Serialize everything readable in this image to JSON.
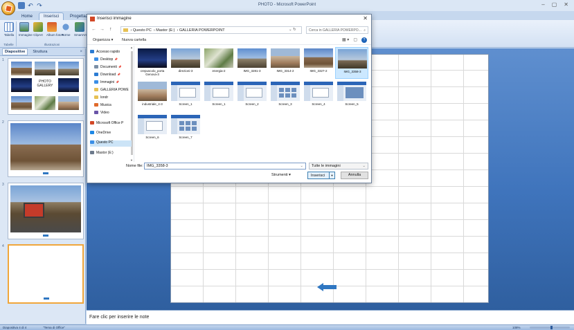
{
  "app": {
    "title": "PHOTO - Microsoft PowerPoint",
    "window_controls": [
      "–",
      "▢",
      "✕"
    ]
  },
  "ribbon": {
    "tabs": [
      "Home",
      "Inserisci",
      "Progettazione"
    ],
    "active_tab": "Inserisci",
    "groups": [
      {
        "label": "Tabelle",
        "buttons": [
          "Tabella"
        ]
      },
      {
        "label": "Illustrazioni",
        "buttons": [
          "Immagine",
          "ClipArt",
          "Album foto ▾",
          "Forme",
          "SmartArt"
        ]
      }
    ]
  },
  "left_pane": {
    "tabs": [
      "Diapositive",
      "Struttura"
    ],
    "close": "×",
    "slides": [
      {
        "number": "1",
        "caption": "PHOTO\nGALLERY"
      },
      {
        "number": "2"
      },
      {
        "number": "3"
      },
      {
        "number": "4"
      }
    ]
  },
  "notes": {
    "placeholder": "Fare clic per inserire le note"
  },
  "status": {
    "slide": "Diapositiva 4 di 4",
    "theme": "\"Tema di Office\"",
    "zoom": "108%",
    "zoom_value": 108
  },
  "dialog": {
    "title": "Inserisci immagine",
    "close": "✕",
    "breadcrumb": [
      "Questo PC",
      "Mastor (E:)",
      "GALLERIA POWERPOINT"
    ],
    "search_placeholder": "Cerca in GALLERIA POWERPO...",
    "toolbar": {
      "organize": "Organizza ▾",
      "new_folder": "Nuova cartella"
    },
    "nav_items": [
      {
        "label": "Accesso rapido",
        "icon": "star-icon"
      },
      {
        "label": "Desktop",
        "icon": "desktop-icon",
        "pinned": true
      },
      {
        "label": "Documenti",
        "icon": "documents-icon",
        "pinned": true
      },
      {
        "label": "Download",
        "icon": "download-icon",
        "pinned": true
      },
      {
        "label": "Immagini",
        "icon": "pictures-icon",
        "pinned": true
      },
      {
        "label": "GALLERIA POWE",
        "icon": "folder-icon"
      },
      {
        "label": "londr",
        "icon": "folder-icon"
      },
      {
        "label": "Musica",
        "icon": "music-icon"
      },
      {
        "label": "Video",
        "icon": "video-icon"
      },
      {
        "label": "Microsoft Office P",
        "icon": "office-icon"
      },
      {
        "label": "OneDrive",
        "icon": "onedrive-icon"
      },
      {
        "label": "Questo PC",
        "icon": "pc-icon",
        "selected": true
      },
      {
        "label": "Mastor (E:)",
        "icon": "drive-icon"
      }
    ],
    "files": [
      {
        "name": "crepuscolo_porta Genova-3",
        "kind": "photo-night"
      },
      {
        "name": "direzioni-3",
        "kind": "photo-sky"
      },
      {
        "name": "energia-2",
        "kind": "photo-green"
      },
      {
        "name": "IMG_3281-3",
        "kind": "photo-sky2"
      },
      {
        "name": "IMG_3314-2",
        "kind": "photo-building"
      },
      {
        "name": "IMG_3327-2",
        "kind": "photo-ruin"
      },
      {
        "name": "IMG_3358-3",
        "kind": "photo-sky",
        "selected": true
      },
      {
        "name": "industriale_4-3",
        "kind": "photo-building"
      },
      {
        "name": "Screen_1",
        "kind": "screen"
      },
      {
        "name": "Screen_1",
        "kind": "screen"
      },
      {
        "name": "Screen_2",
        "kind": "screen"
      },
      {
        "name": "Screen_3",
        "kind": "screen-grid"
      },
      {
        "name": "Screen_4",
        "kind": "screen"
      },
      {
        "name": "Screen_5",
        "kind": "screen-photos"
      },
      {
        "name": "Screen_6",
        "kind": "screen"
      },
      {
        "name": "Screen_7",
        "kind": "screen-grid"
      }
    ],
    "filename_label": "Nome file:",
    "filename_value": "IMG_3358-3",
    "filter": "Tutte le immagini",
    "tools": "Strumenti ▾",
    "insert": "Inserisci",
    "cancel": "Annulla"
  }
}
